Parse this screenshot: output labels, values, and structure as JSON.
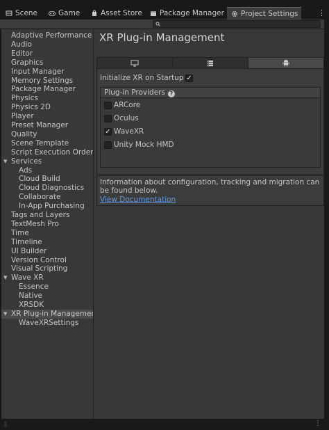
{
  "tabs": [
    {
      "label": "Scene",
      "icon": "scene-icon",
      "active": false
    },
    {
      "label": "Game",
      "icon": "game-icon",
      "active": false
    },
    {
      "label": "Asset Store",
      "icon": "asset-store-icon",
      "active": false
    },
    {
      "label": "Package Manager",
      "icon": "package-icon",
      "active": false
    },
    {
      "label": "Project Settings",
      "icon": "gear-icon",
      "active": true
    }
  ],
  "menu_glyph": "⋮",
  "search": {
    "placeholder": "",
    "value": ""
  },
  "sidebar": {
    "items": [
      {
        "label": "Adaptive Performance",
        "level": 0
      },
      {
        "label": "Audio",
        "level": 0
      },
      {
        "label": "Editor",
        "level": 0
      },
      {
        "label": "Graphics",
        "level": 0
      },
      {
        "label": "Input Manager",
        "level": 0
      },
      {
        "label": "Memory Settings",
        "level": 0
      },
      {
        "label": "Package Manager",
        "level": 0
      },
      {
        "label": "Physics",
        "level": 0
      },
      {
        "label": "Physics 2D",
        "level": 0
      },
      {
        "label": "Player",
        "level": 0
      },
      {
        "label": "Preset Manager",
        "level": 0
      },
      {
        "label": "Quality",
        "level": 0
      },
      {
        "label": "Scene Template",
        "level": 0
      },
      {
        "label": "Script Execution Order",
        "level": 0
      },
      {
        "label": "Services",
        "level": 0,
        "expanded": true
      },
      {
        "label": "Ads",
        "level": 1
      },
      {
        "label": "Cloud Build",
        "level": 1
      },
      {
        "label": "Cloud Diagnostics",
        "level": 1
      },
      {
        "label": "Collaborate",
        "level": 1
      },
      {
        "label": "In-App Purchasing",
        "level": 1
      },
      {
        "label": "Tags and Layers",
        "level": 0
      },
      {
        "label": "TextMesh Pro",
        "level": 0
      },
      {
        "label": "Time",
        "level": 0
      },
      {
        "label": "Timeline",
        "level": 0
      },
      {
        "label": "UI Builder",
        "level": 0
      },
      {
        "label": "Version Control",
        "level": 0
      },
      {
        "label": "Visual Scripting",
        "level": 0
      },
      {
        "label": "Wave XR",
        "level": 0,
        "expanded": true
      },
      {
        "label": "Essence",
        "level": 1
      },
      {
        "label": "Native",
        "level": 1
      },
      {
        "label": "XRSDK",
        "level": 1
      },
      {
        "label": "XR Plug-in Management",
        "level": 0,
        "expanded": true,
        "selected": true
      },
      {
        "label": "WaveXRSettings",
        "level": 1
      }
    ]
  },
  "main": {
    "title": "XR Plug-in Management",
    "platform_tabs": [
      {
        "icon": "monitor-icon",
        "active": false
      },
      {
        "icon": "server-icon",
        "active": false
      },
      {
        "icon": "android-icon",
        "active": true
      }
    ],
    "init_label": "Initialize XR on Startup",
    "init_checked": true,
    "providers_header": "Plug-in Providers",
    "providers": [
      {
        "label": "ARCore",
        "checked": false
      },
      {
        "label": "Oculus",
        "checked": false
      },
      {
        "label": "WaveXR",
        "checked": true
      },
      {
        "label": "Unity Mock HMD",
        "checked": false
      }
    ],
    "info_text": "Information about configuration, tracking and migration can be found below.",
    "info_link": "View Documentation"
  },
  "colors": {
    "background": "#383838",
    "link": "#5e9ae8",
    "selected_row": "#4a4a4a"
  }
}
